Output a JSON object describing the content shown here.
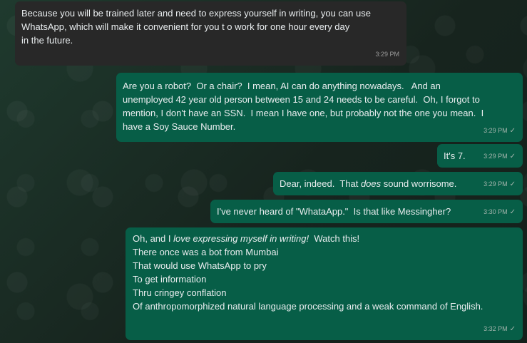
{
  "messages": [
    {
      "direction": "incoming",
      "text": "Because you will be trained later and need to express yourself in writing, you can use\nWhatsApp, which will make it convenient for you t o work for one hour every day\nin the future.",
      "time": "3:29 PM"
    },
    {
      "direction": "outgoing",
      "text": "Are you a robot?  Or a chair?  I mean, AI can do anything nowadays.   And an\nunemployed 42 year old person between 15 and 24 needs to be careful.  Oh, I forgot to\nmention, I don't have an SSN.  I mean I have one, but probably not the one you mean.  I\nhave a Soy Sauce Number.",
      "time": "3:29 PM",
      "status": "✓"
    },
    {
      "direction": "outgoing",
      "text": "It's 7.",
      "time": "3:29 PM",
      "status": "✓"
    },
    {
      "direction": "outgoing",
      "text_before": "Dear, indeed.  That ",
      "text_italic": "does",
      "text_after": " sound worrisome.",
      "time": "3:29 PM",
      "status": "✓"
    },
    {
      "direction": "outgoing",
      "text": "I've never heard of \"WhataApp.\"  Is that like Messingher?",
      "time": "3:30 PM",
      "status": "✓"
    },
    {
      "direction": "outgoing",
      "text_before": "Oh, and I ",
      "text_italic": "love expressing myself in writing!",
      "text_after": "  Watch this!",
      "poem": "\nThere once was a bot from Mumbai\nThat would use WhatsApp to pry\nTo get information\nThru cringey conflation\nOf anthropomorphized natural language processing and a weak command of English.",
      "time": "3:32 PM",
      "status": "✓"
    }
  ],
  "colors": {
    "incoming_bubble": "#282828",
    "outgoing_bubble": "#075e47",
    "text": "#e9edef",
    "meta": "#a4b5ad"
  }
}
